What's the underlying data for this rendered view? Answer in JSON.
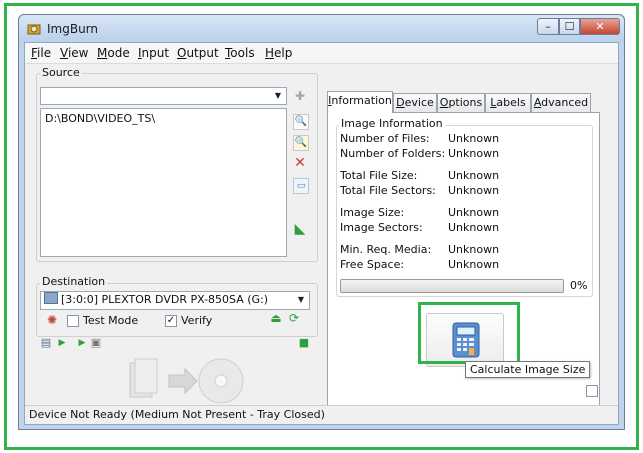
{
  "window": {
    "title": "ImgBurn",
    "close_glyph": "✕",
    "min_glyph": "–",
    "max_glyph": "☐"
  },
  "menu": [
    "File",
    "View",
    "Mode",
    "Input",
    "Output",
    "Tools",
    "Help"
  ],
  "source": {
    "label": "Source",
    "combo_value": "",
    "list_items": [
      "D:\\BOND\\VIDEO_TS\\"
    ]
  },
  "destination": {
    "label": "Destination",
    "drive": "[3:0:0] PLEXTOR DVDR   PX-850SA (G:)",
    "test_mode_label": "Test Mode",
    "test_mode_checked": false,
    "verify_label": "Verify",
    "verify_checked": true,
    "verify_mark": "✓"
  },
  "tabs": [
    "Information",
    "Device",
    "Options",
    "Labels",
    "Advanced"
  ],
  "info": {
    "group_label": "Image Information",
    "rows": [
      {
        "label": "Number of Files:",
        "value": "Unknown"
      },
      {
        "label": "Number of Folders:",
        "value": "Unknown"
      },
      {
        "label": "Total File Size:",
        "value": "Unknown"
      },
      {
        "label": "Total File Sectors:",
        "value": "Unknown"
      },
      {
        "label": "Image Size:",
        "value": "Unknown"
      },
      {
        "label": "Image Sectors:",
        "value": "Unknown"
      },
      {
        "label": "Min. Req. Media:",
        "value": "Unknown"
      },
      {
        "label": "Free Space:",
        "value": "Unknown"
      }
    ],
    "progress_text": "0%",
    "progress_value": 0
  },
  "calculate_tooltip": "Calculate Image Size",
  "status": "Device Not Ready (Medium Not Present - Tray Closed)",
  "colors": {
    "highlight": "#2fb34a"
  }
}
